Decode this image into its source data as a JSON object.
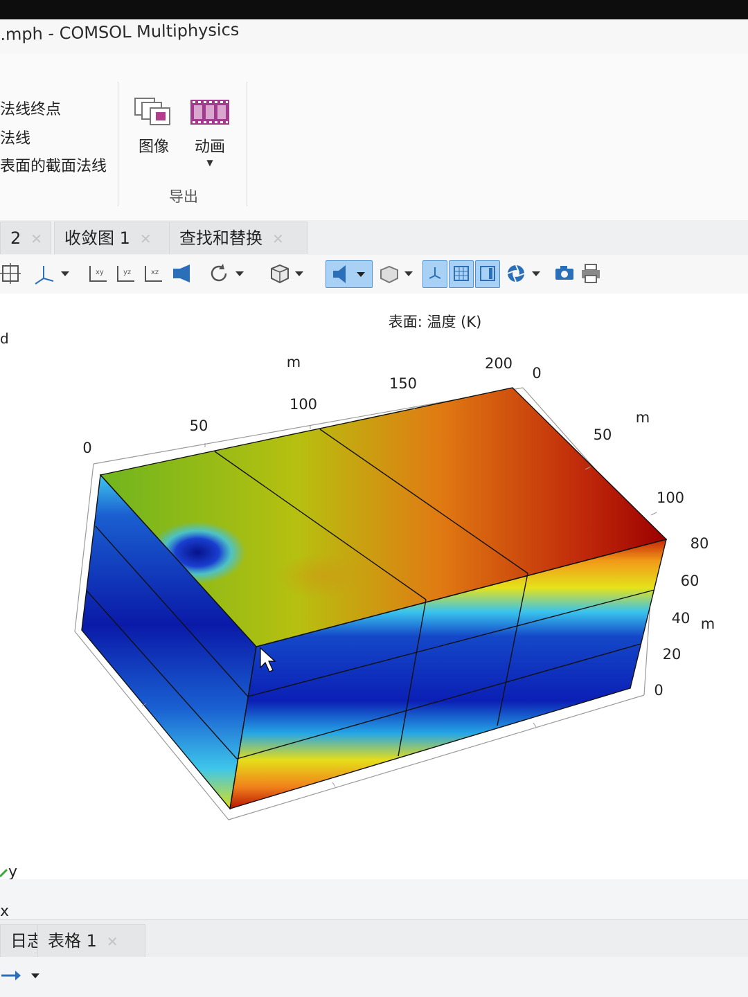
{
  "window": {
    "title": ".mph - COMSOL Multiphysics"
  },
  "ribbon": {
    "commands": [
      "法线终点",
      "法线",
      "表面的截面法线"
    ],
    "buttons": [
      {
        "label": "图像",
        "icon": "image-export-icon"
      },
      {
        "label": "动画",
        "icon": "film-strip-icon"
      }
    ],
    "group_label": "导出"
  },
  "tabs": [
    {
      "label": "2"
    },
    {
      "label": "收敛图 1"
    },
    {
      "label": "查找和替换"
    }
  ],
  "plot": {
    "title": "表面: 温度 (K)",
    "colors": {
      "hot": "#a00000",
      "warm": "#f4a11a",
      "mid": "#e6e21a",
      "cool": "#36c6f0",
      "cold": "#0a1fb8"
    },
    "axes": {
      "x_ticks": [
        "0",
        "50",
        "100",
        "150",
        "200"
      ],
      "x_unit": "m",
      "y_ticks": [
        "0",
        "50",
        "100"
      ],
      "y_unit": "m",
      "z_ticks": [
        "0",
        "20",
        "40",
        "60",
        "80"
      ],
      "z_unit": "m"
    },
    "triad": {
      "y": "y",
      "x": "x"
    },
    "corner_label": "d"
  },
  "bottom_tabs": [
    {
      "label": "日志"
    },
    {
      "label": "表格 1"
    }
  ]
}
